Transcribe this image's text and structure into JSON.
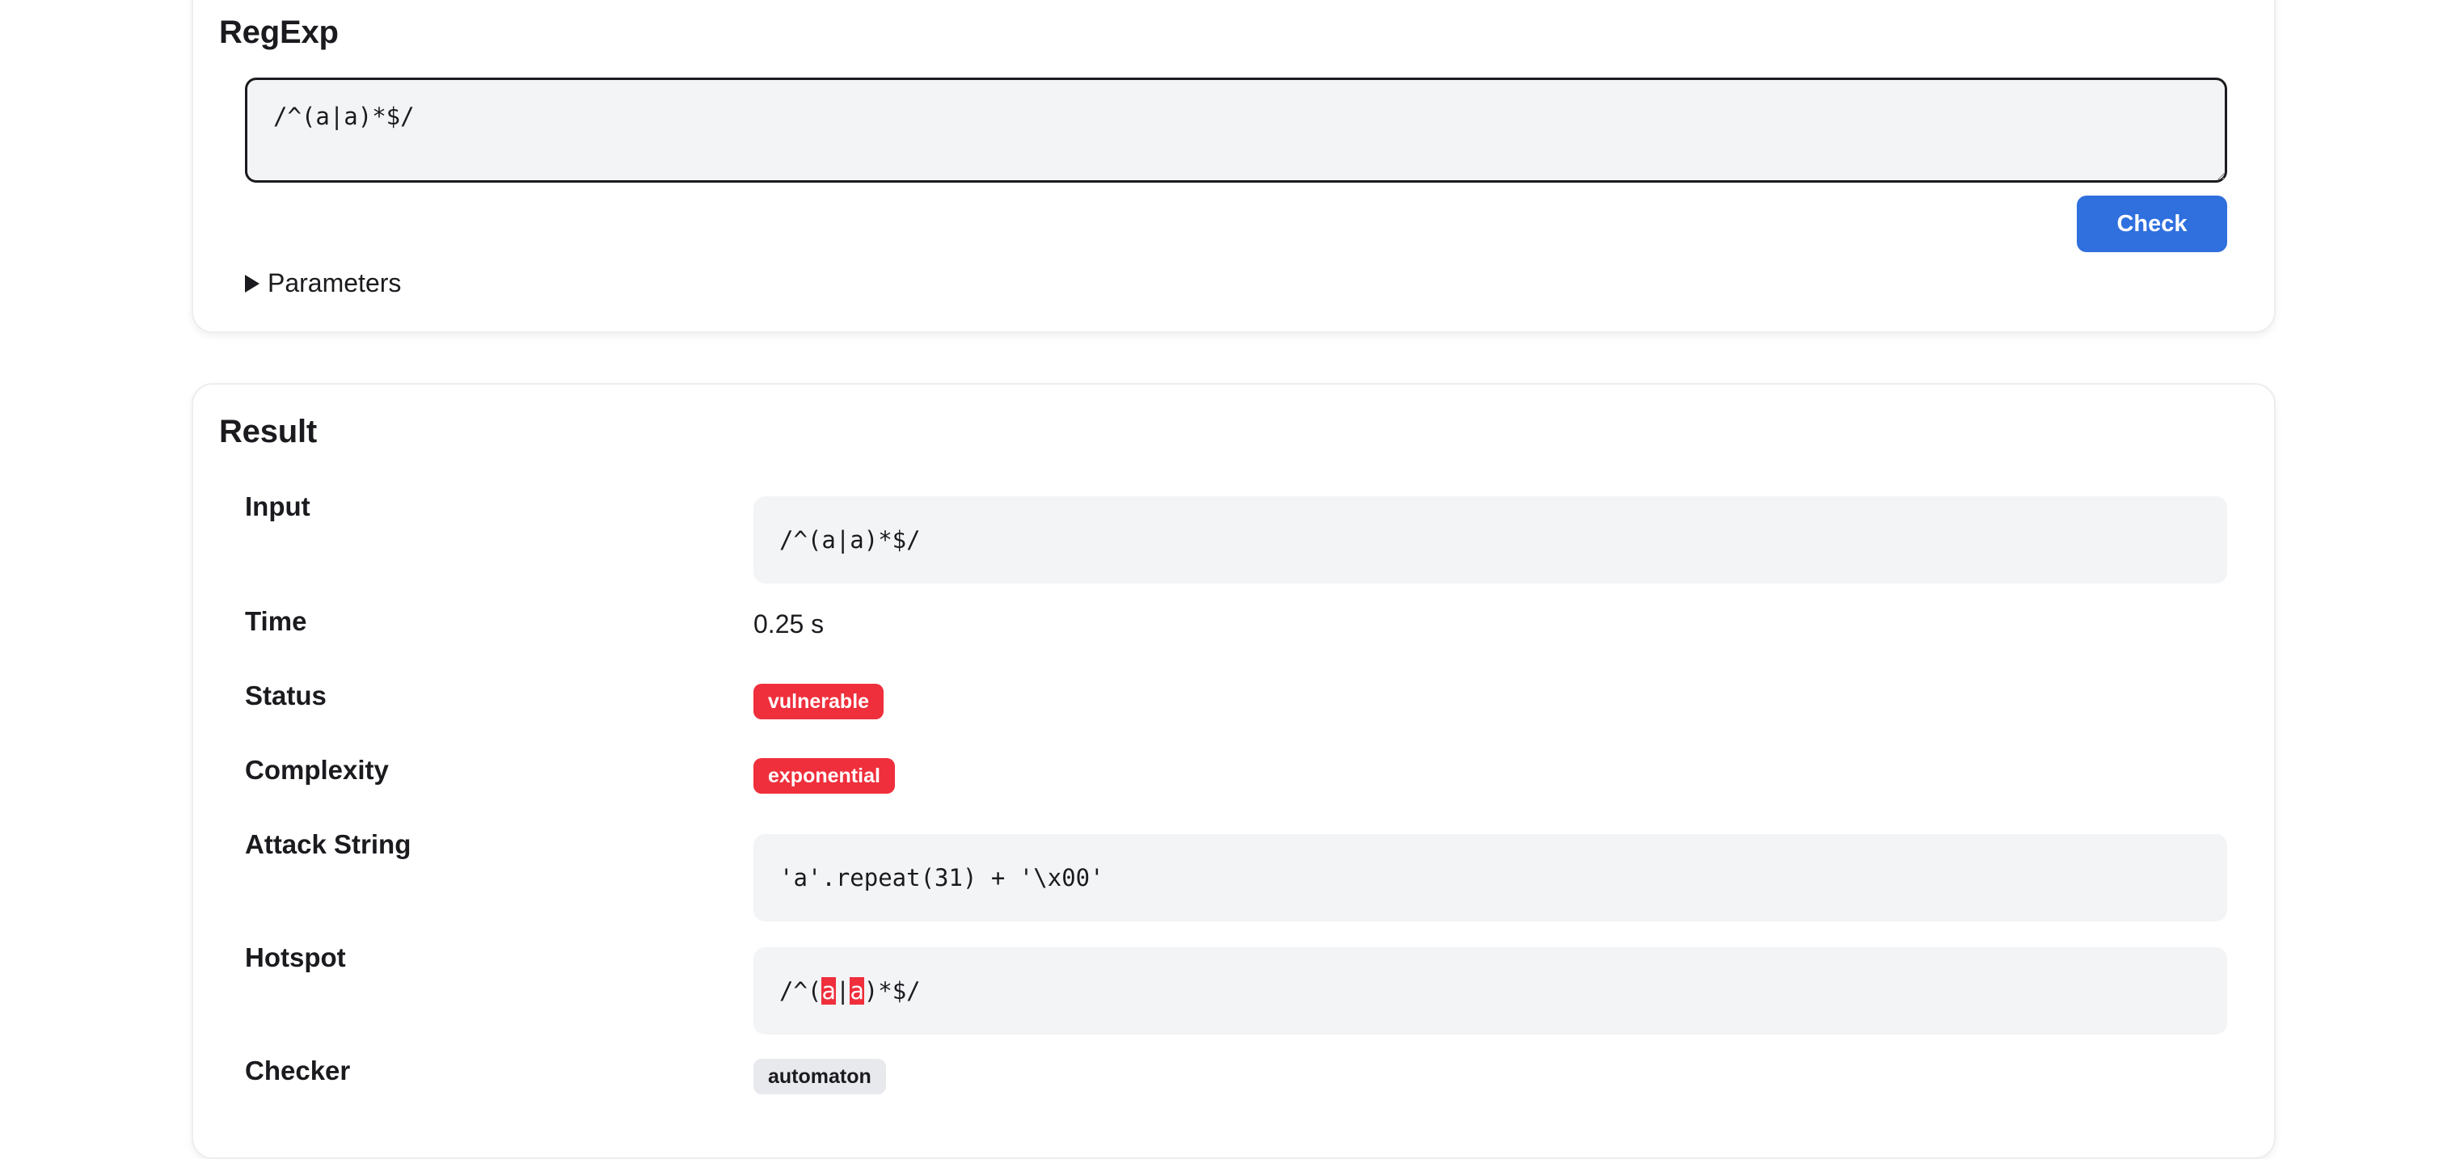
{
  "regexp_card": {
    "title": "RegExp",
    "input_value": "/^(a|a)*$/",
    "check_label": "Check",
    "parameters_label": "Parameters"
  },
  "result_card": {
    "title": "Result",
    "input_label": "Input",
    "input_value": "/^(a|a)*$/",
    "time_label": "Time",
    "time_value": "0.25 s",
    "status_label": "Status",
    "status_value": "vulnerable",
    "complexity_label": "Complexity",
    "complexity_value": "exponential",
    "attack_label": "Attack String",
    "attack_value": "'a'.repeat(31) + '\\x00'",
    "hotspot_label": "Hotspot",
    "hotspot_parts": [
      "/^(",
      "a",
      "|",
      "a",
      ")*$/"
    ],
    "checker_label": "Checker",
    "checker_value": "automaton"
  },
  "colors": {
    "accent_blue": "#2f6fde",
    "danger_red": "#ef2f3c",
    "code_bg": "#f3f4f6"
  },
  "icons": {
    "parameters_toggle": "triangle-right-icon"
  }
}
